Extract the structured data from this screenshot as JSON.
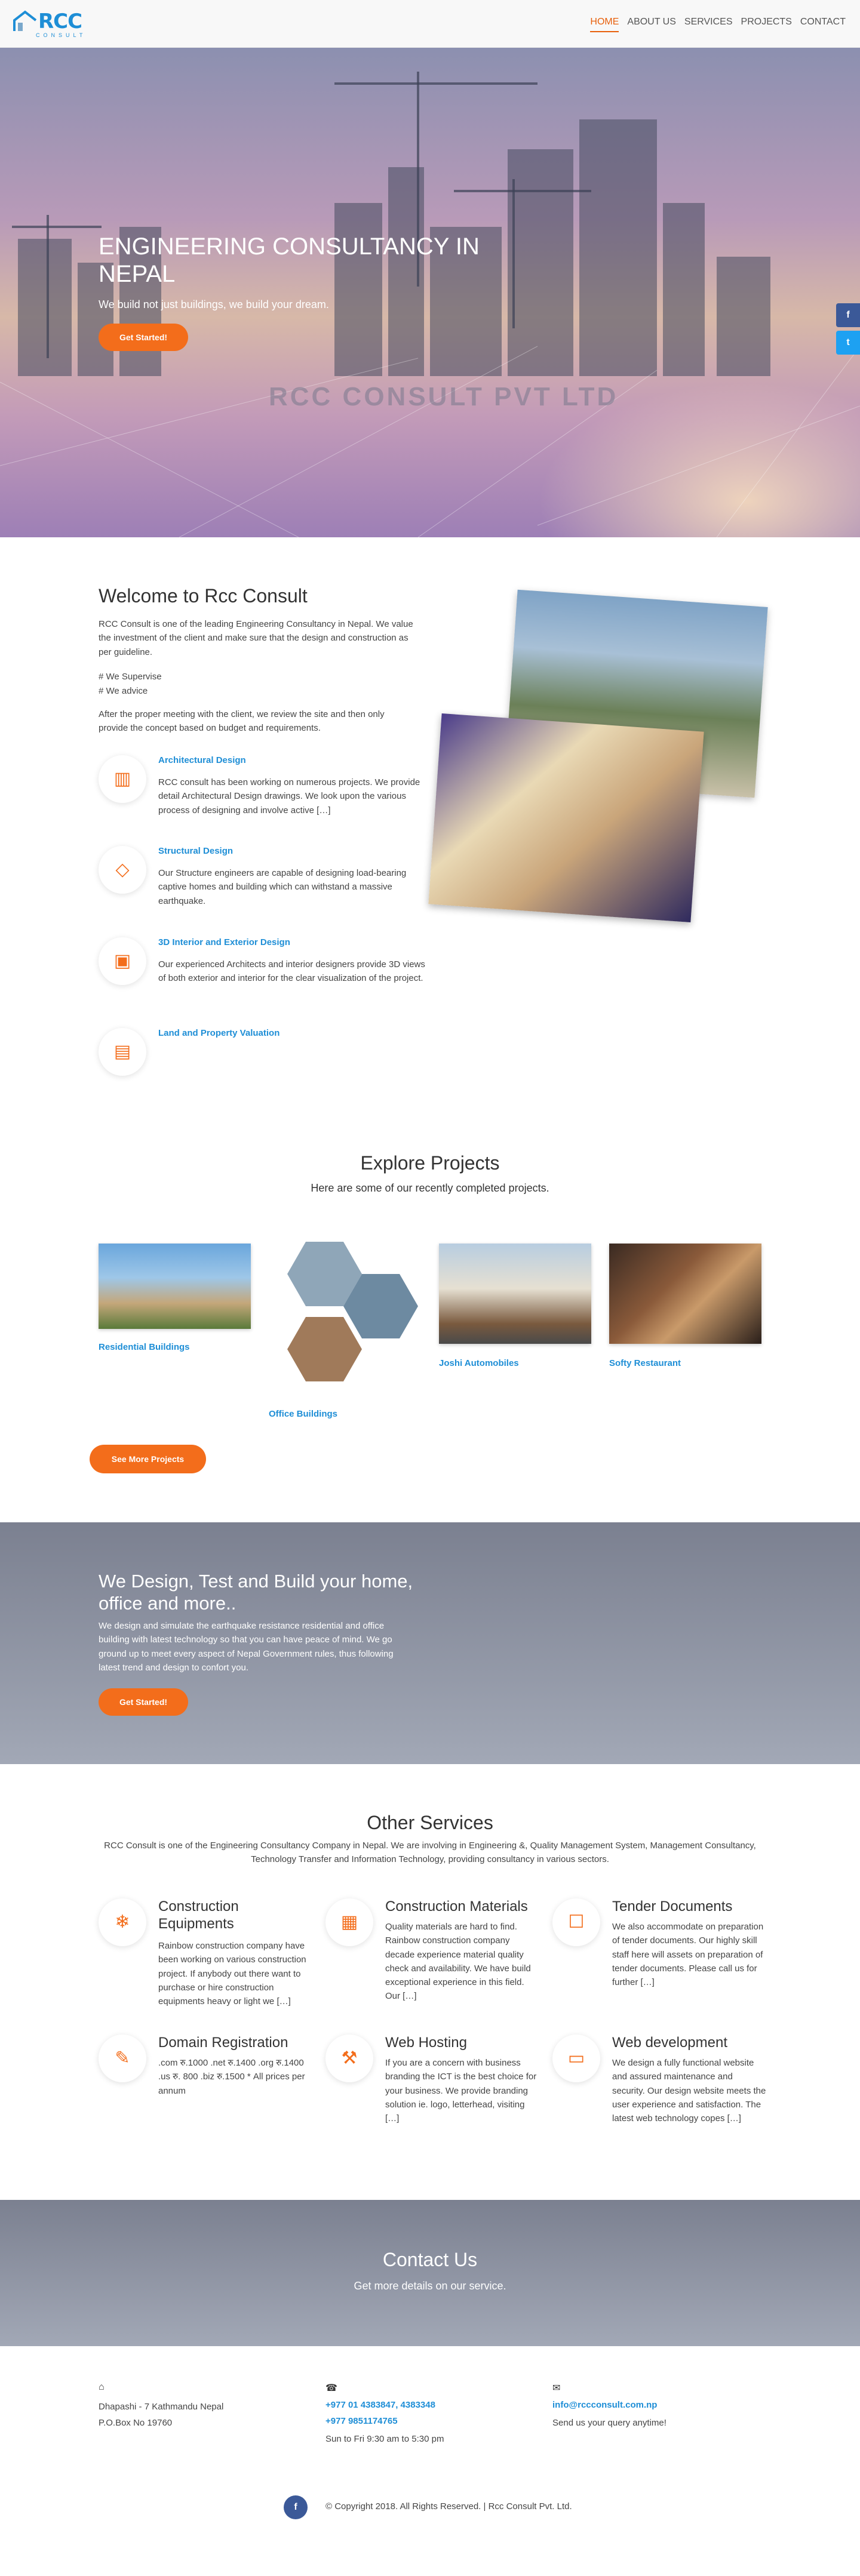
{
  "header": {
    "logo_text": "RCC",
    "logo_sub": "CONSULT",
    "nav": [
      "HOME",
      "ABOUT US",
      "SERVICES",
      "PROJECTS",
      "CONTACT"
    ]
  },
  "hero": {
    "title": "ENGINEERING CONSULTANCY IN NEPAL",
    "subtitle": "We build not just buildings, we build your dream.",
    "button": "Get Started!",
    "watermark": "RCC CONSULT PVT LTD",
    "social_facebook": "f",
    "social_twitter": "t"
  },
  "welcome": {
    "title": "Welcome to Rcc Consult",
    "intro": "RCC Consult is one of the leading Engineering Consultancy in Nepal. We value the investment of the client and make sure that the design and construction as per guideline.",
    "point1": "# We Supervise",
    "point2": "# We advice",
    "after": "After the proper meeting with the client, we review the site and then only provide the concept based on budget and requirements.",
    "services": [
      {
        "title": "Architectural Design",
        "text": "RCC consult has been working on numerous projects. We provide detail Architectural Design drawings. We look upon the various process of designing and involve active […]",
        "icon": "▥"
      },
      {
        "title": "Structural Design",
        "text": "Our Structure engineers are capable of designing load-bearing captive homes and building which can withstand a massive earthquake.",
        "icon": "◇"
      },
      {
        "title": "3D Interior and Exterior Design",
        "text": "Our experienced Architects and interior designers provide 3D views of both exterior and interior for the clear visualization of the project.",
        "icon": "▣"
      },
      {
        "title": "Land and Property Valuation",
        "text": "",
        "icon": "▤"
      }
    ]
  },
  "projects": {
    "title": "Explore Projects",
    "subtitle": "Here are some of our recently completed projects.",
    "items": [
      "Residential Buildings",
      "Office Buildings",
      "Joshi Automobiles",
      "Softy Restaurant"
    ],
    "button": "See More Projects"
  },
  "design": {
    "title": "We Design, Test and Build your home, office and more..",
    "text": "We design and simulate the earthquake resistance residential and office building with latest technology so that you can have peace of mind. We go ground up to meet every aspect of Nepal Government rules, thus following latest trend and design to confort you.",
    "button": "Get Started!"
  },
  "other_services": {
    "title": "Other Services",
    "subtitle": "RCC Consult is one of the Engineering Consultancy Company in Nepal. We are involving in Engineering &, Quality Management System, Management Consultancy, Technology Transfer and Information Technology, providing consultancy in various sectors.",
    "items": [
      {
        "title": "Construction Equipments",
        "text": "Rainbow construction company have been working on various construction project. If anybody out there want to purchase or hire construction equipments heavy or light we […]",
        "icon": "❄"
      },
      {
        "title": "Construction Materials",
        "text": "Quality materials are hard to find. Rainbow construction company decade experience material quality check and availability. We have build exceptional experience in this field. Our […]",
        "icon": "▦"
      },
      {
        "title": "Tender Documents",
        "text": "We also accommodate on preparation of  tender documents. Our highly skill staff here will assets on preparation of tender documents. Please call us for further […]",
        "icon": "☐"
      },
      {
        "title": "Domain Registration",
        "text": ".com रु.1000 .net रु.1400 .org रु.1400 .us रु. 800 .biz रु.1500 * All prices per annum",
        "icon": "✎"
      },
      {
        "title": "Web Hosting",
        "text": "If you are a concern with business branding the ICT is the best choice for your business. We provide branding solution ie. logo, letterhead, visiting […]",
        "icon": "⚒"
      },
      {
        "title": "Web development",
        "text": "We design a fully functional website and assured maintenance and security. Our design website meets the user experience and satisfaction. The latest web technology copes […]",
        "icon": "▭"
      }
    ]
  },
  "contact": {
    "title": "Contact Us",
    "subtitle": "Get more details on our service."
  },
  "footer": {
    "address_line1": "Dhapashi - 7 Kathmandu Nepal",
    "address_line2": "P.O.Box No 19760",
    "phone1": "+977 01 4383847, 4383348",
    "phone2": "+977 9851174765",
    "hours": "Sun to Fri 9:30 am to 5:30 pm",
    "email": "info@rccconsult.com.np",
    "email_note": "Send us your query anytime!",
    "copyright": "© Copyright 2018. All Rights Reserved. | Rcc Consult Pvt. Ltd.",
    "fb": "f"
  }
}
